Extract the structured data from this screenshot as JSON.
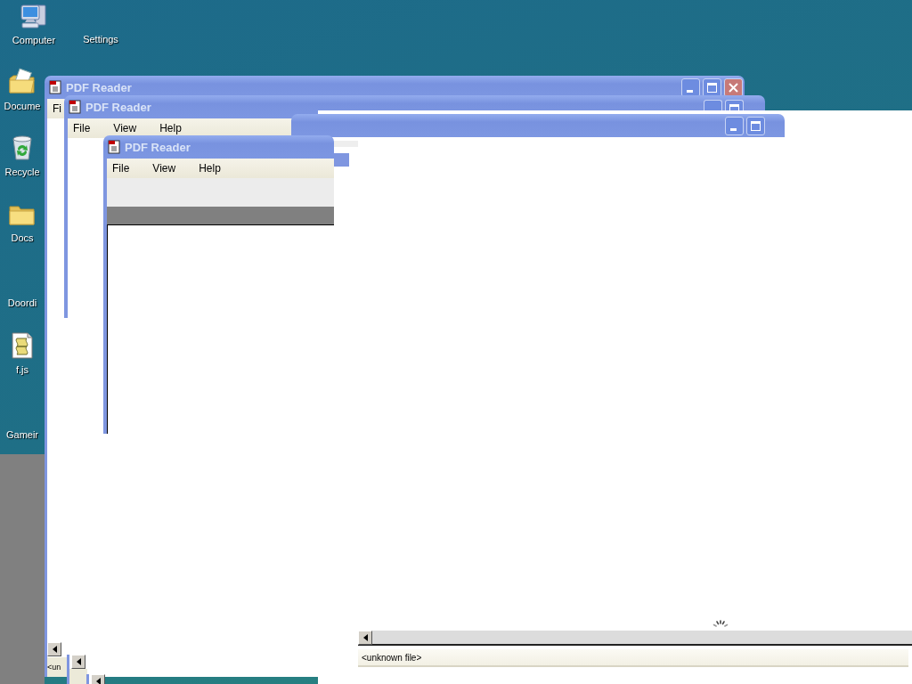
{
  "desktop": {
    "icons": [
      {
        "label": "Computer",
        "kind": "computer"
      },
      {
        "label": "Settings",
        "kind": "none"
      },
      {
        "label": "Docume",
        "kind": "documents"
      },
      {
        "label": "Recycle",
        "kind": "recycle"
      },
      {
        "label": "Docs",
        "kind": "folder"
      },
      {
        "label": "Doordi",
        "kind": "none"
      },
      {
        "label": "f.js",
        "kind": "script"
      },
      {
        "label": "Gameir",
        "kind": "none"
      }
    ]
  },
  "windows": [
    {
      "title": "PDF Reader",
      "menu": [
        "Fi"
      ],
      "controls": [
        {
          "kind": "minimize"
        },
        {
          "kind": "maximize"
        },
        {
          "kind": "close"
        }
      ],
      "status": "<un"
    },
    {
      "title": "PDF Reader",
      "menu": [
        "File",
        "View",
        "Help"
      ],
      "controls": [
        {
          "kind": "minimize"
        },
        {
          "kind": "maximize"
        }
      ]
    },
    {
      "controls": [
        {
          "kind": "minimize"
        },
        {
          "kind": "maximize"
        }
      ]
    },
    {
      "title": "PDF Reader",
      "menu": [
        "File",
        "View",
        "Help"
      ]
    }
  ],
  "viewer": {
    "status": "<unknown file>"
  }
}
